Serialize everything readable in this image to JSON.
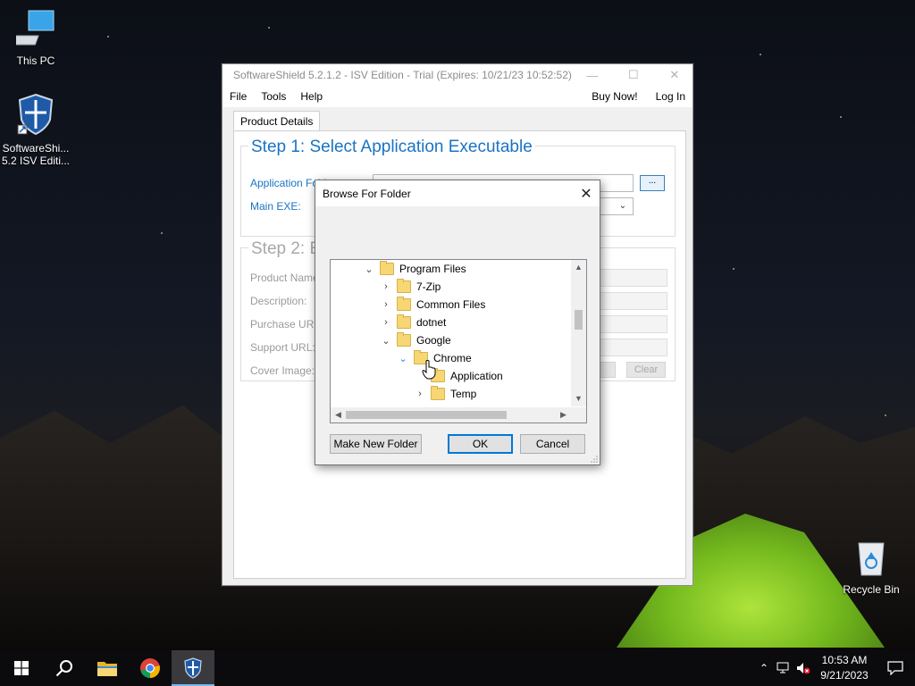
{
  "desktop": {
    "icons": [
      {
        "label": "This PC"
      },
      {
        "label_line1": "SoftwareShi...",
        "label_line2": "5.2 ISV Editi..."
      },
      {
        "label": "Recycle Bin"
      }
    ]
  },
  "app": {
    "title": "SoftwareShield 5.2.1.2 - ISV Edition - Trial (Expires: 10/21/23 10:52:52)",
    "menu": {
      "file": "File",
      "tools": "Tools",
      "help": "Help",
      "buy_now": "Buy Now!",
      "log_in": "Log In"
    },
    "tab": "Product Details",
    "step1": {
      "title": "Step 1: Select Application Executable",
      "app_folder_label": "Application Folder:",
      "main_exe_label": "Main EXE:",
      "browse_label": "..."
    },
    "step2": {
      "title": "Step 2: E",
      "product_name_label": "Product Name:",
      "description_label": "Description:",
      "purchase_url_label": "Purchase URL:",
      "support_url_label": "Support URL:",
      "cover_image_label": "Cover Image:",
      "clear_label": "Clear"
    }
  },
  "dialog": {
    "title": "Browse For Folder",
    "tree": [
      {
        "label": "Program Files",
        "expanded": true
      },
      {
        "label": "7-Zip",
        "expanded": false
      },
      {
        "label": "Common Files",
        "expanded": false
      },
      {
        "label": "dotnet",
        "expanded": false
      },
      {
        "label": "Google",
        "expanded": true
      },
      {
        "label": "Chrome",
        "expanded": true
      },
      {
        "label": "Application",
        "expanded": false
      },
      {
        "label": "Temp",
        "expanded": false
      }
    ],
    "buttons": {
      "new_folder": "Make New Folder",
      "ok": "OK",
      "cancel": "Cancel"
    }
  },
  "taskbar": {
    "items": [
      "start-icon",
      "search-icon",
      "file-explorer-icon",
      "chrome-icon",
      "softwareshield-icon"
    ],
    "clock": {
      "time": "10:53 AM",
      "date": "9/21/2023"
    }
  },
  "colors": {
    "accent_blue": "#1a73c4",
    "taskbar": "#0b0b0d",
    "folder_yellow": "#f7d774"
  }
}
